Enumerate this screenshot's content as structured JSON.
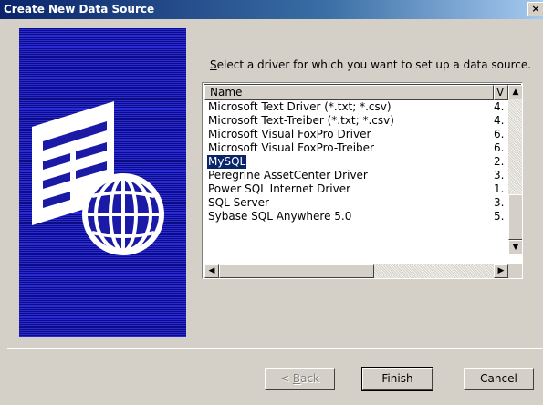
{
  "window": {
    "title": "Create New Data Source",
    "close_glyph": "×"
  },
  "icons": {
    "banner": "data-source-globe-icon",
    "close": "close-icon",
    "scroll_up": "arrow-up-icon",
    "scroll_down": "arrow-down-icon",
    "scroll_left": "arrow-left-icon",
    "scroll_right": "arrow-right-icon"
  },
  "prompt": {
    "accel": "S",
    "rest": "elect a driver for which you want to set up a data source."
  },
  "driver_list": {
    "columns": [
      "Name",
      "V"
    ],
    "selected_index": 4,
    "rows": [
      {
        "name": "Microsoft Text Driver (*.txt; *.csv)",
        "version": "4."
      },
      {
        "name": "Microsoft Text-Treiber (*.txt; *.csv)",
        "version": "4."
      },
      {
        "name": "Microsoft Visual FoxPro Driver",
        "version": "6."
      },
      {
        "name": "Microsoft Visual FoxPro-Treiber",
        "version": "6."
      },
      {
        "name": "MySQL",
        "version": "2."
      },
      {
        "name": "Peregrine AssetCenter Driver",
        "version": "3."
      },
      {
        "name": "Power SQL Internet Driver",
        "version": "1."
      },
      {
        "name": "SQL Server",
        "version": "3."
      },
      {
        "name": "Sybase SQL Anywhere 5.0",
        "version": "5."
      }
    ]
  },
  "buttons": {
    "back": {
      "accel": "B",
      "label_prefix": "< ",
      "label_rest": "ack",
      "enabled": false
    },
    "finish": "Finish",
    "cancel": "Cancel"
  },
  "colors": {
    "titlebar_start": "#0a246a",
    "titlebar_end": "#a6caf0",
    "panel_blue": "#1a1aa6",
    "selection": "#0a246a",
    "face": "#d4d0c8"
  }
}
